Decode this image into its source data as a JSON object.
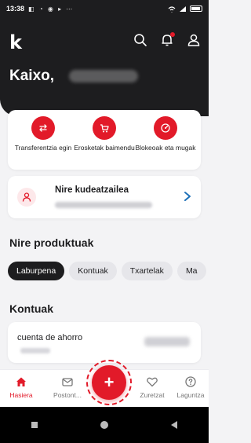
{
  "status_bar": {
    "time": "13:38"
  },
  "app": {
    "logo": "k"
  },
  "header": {
    "greeting": "Kaixo,"
  },
  "quick_actions": [
    {
      "label": "Transferentzia egin",
      "icon": "transfer-icon"
    },
    {
      "label": "Erosketak baimendu",
      "icon": "cart-icon"
    },
    {
      "label": "Blokeoak eta mugak",
      "icon": "gauge-icon"
    }
  ],
  "manager_card": {
    "title": "Nire kudeatzailea"
  },
  "products": {
    "title": "Nire produktuak",
    "tabs": [
      "Laburpena",
      "Kontuak",
      "Txartelak",
      "Ma"
    ]
  },
  "accounts": {
    "title": "Kontuak",
    "items": [
      {
        "name": "cuenta de ahorro"
      }
    ]
  },
  "tab_bar": {
    "items": [
      "Hasiera",
      "Postont...",
      "Zuretzat",
      "Laguntza"
    ]
  },
  "fab": {
    "label": "+"
  },
  "colors": {
    "accent": "#e21a29",
    "dark": "#1d1d1f",
    "background": "#f3f3f5"
  }
}
